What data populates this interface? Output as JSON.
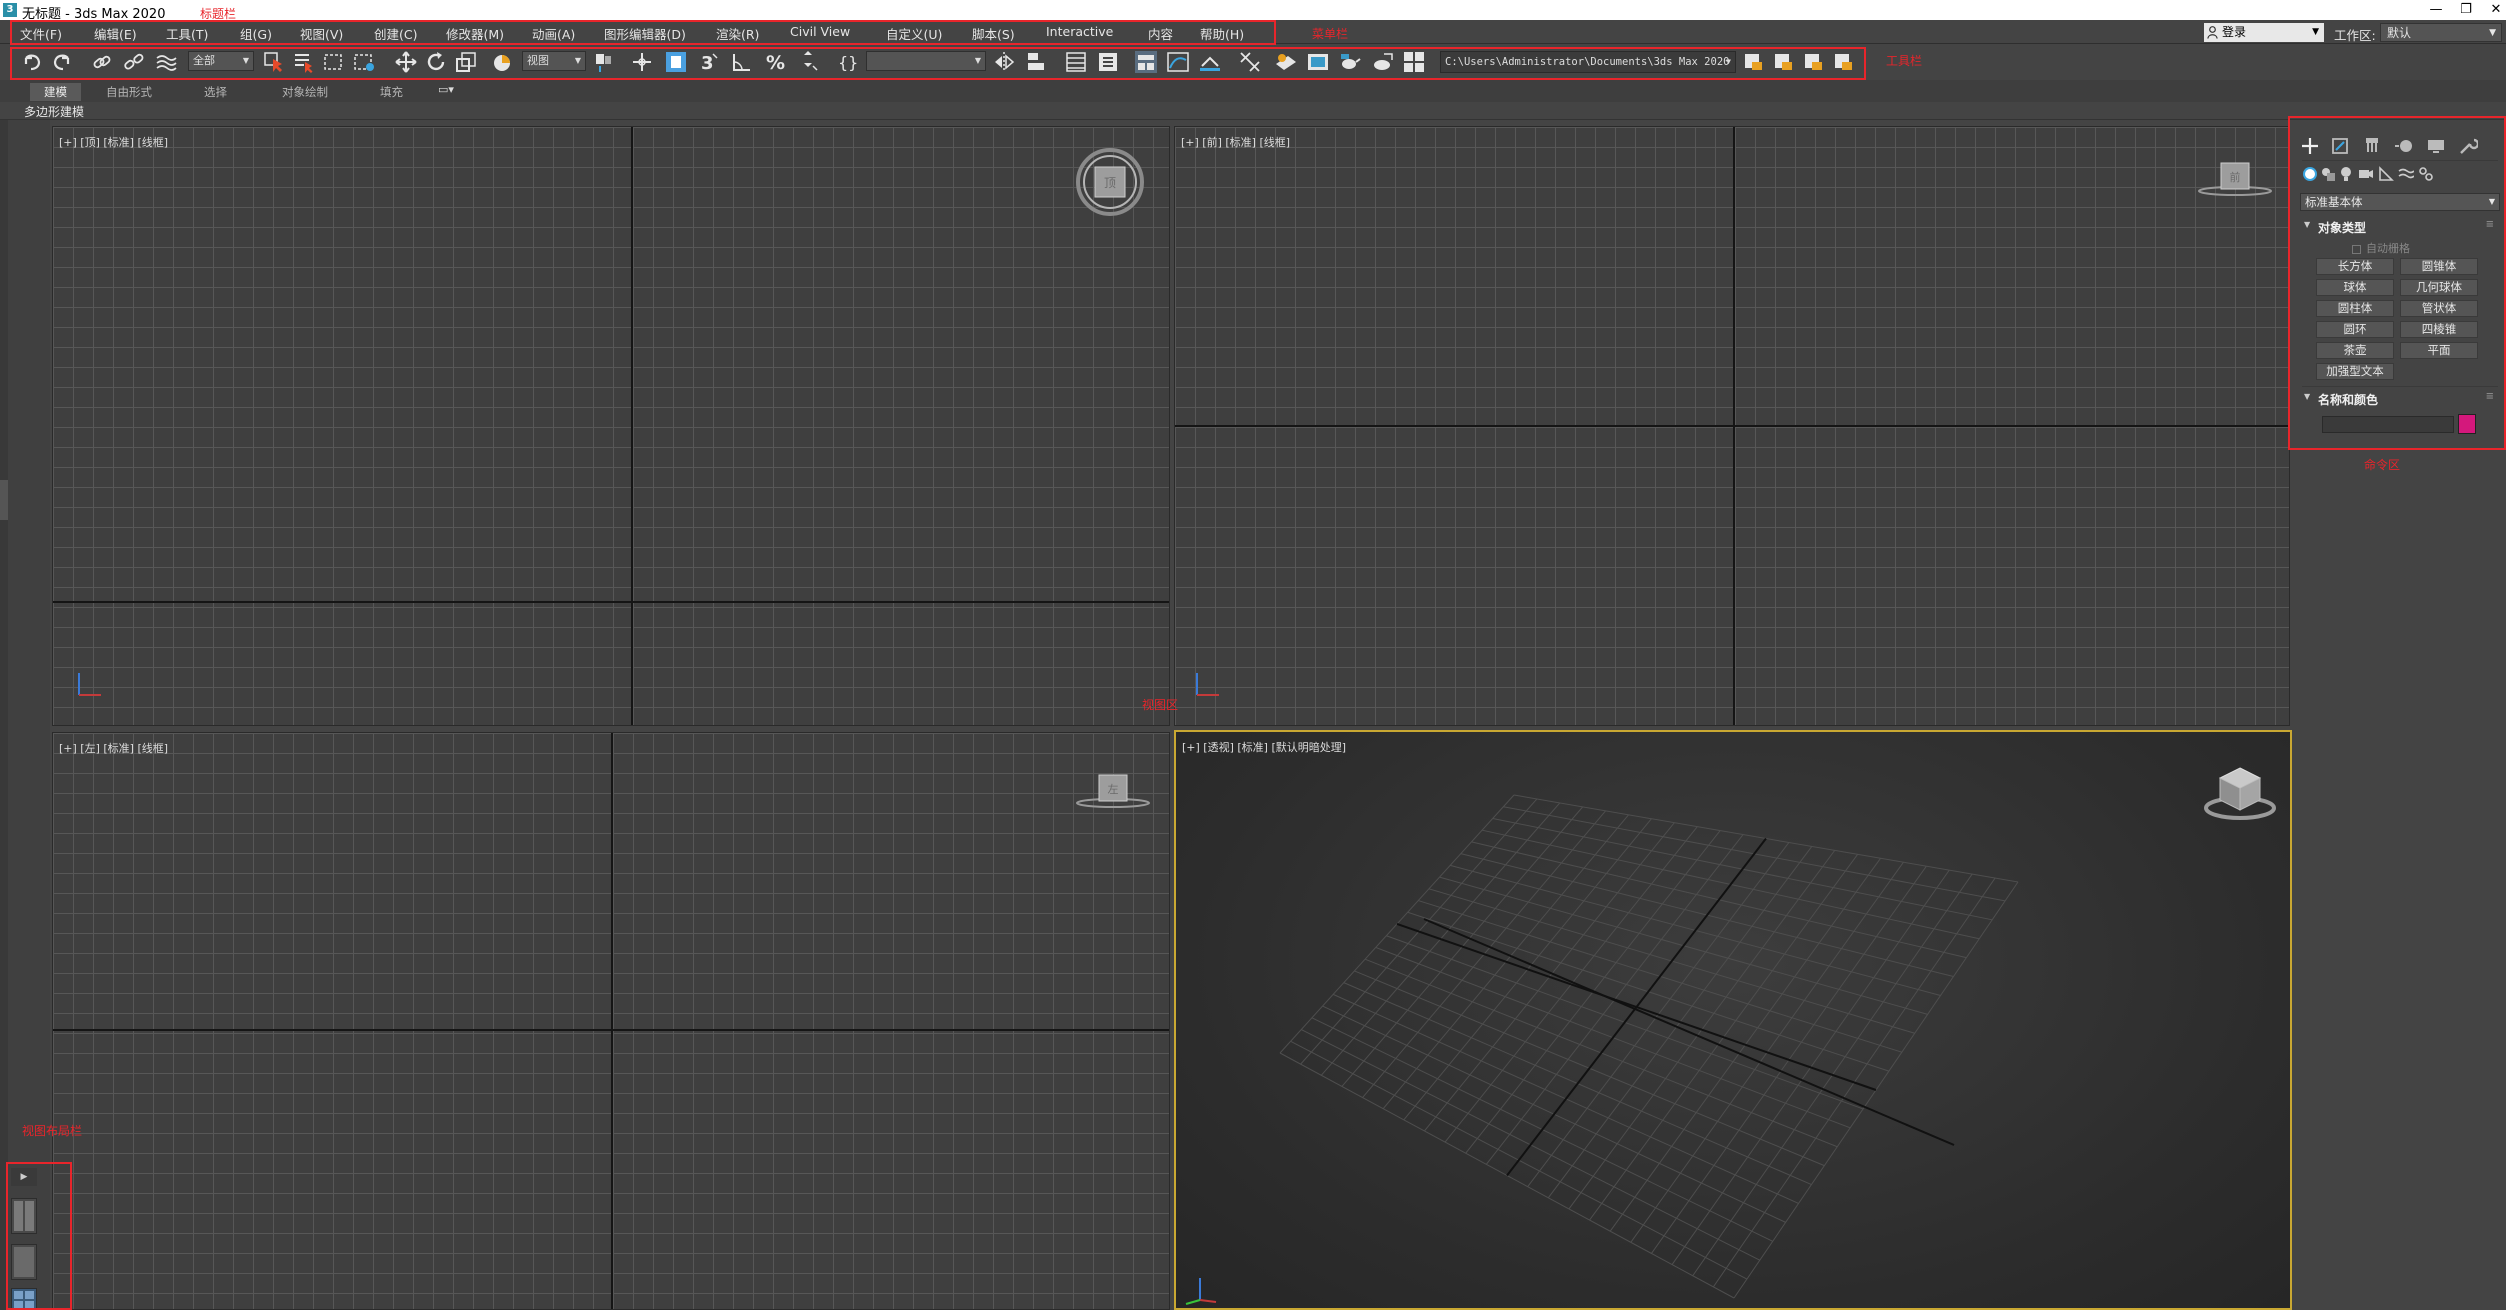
{
  "window": {
    "title": "无标题 - 3ds Max 2020",
    "app_icon": "3",
    "min": "—",
    "restore": "❐",
    "close": "✕"
  },
  "annotations": {
    "title_bar": "标题栏",
    "menu_bar": "菜单栏",
    "toolbar": "工具栏",
    "viewport": "视图区",
    "command_panel": "命令区",
    "layout_bar": "视图布局栏"
  },
  "menu": {
    "items": [
      "文件(F)",
      "编辑(E)",
      "工具(T)",
      "组(G)",
      "视图(V)",
      "创建(C)",
      "修改器(M)",
      "动画(A)",
      "图形编辑器(D)",
      "渲染(R)",
      "Civil View",
      "自定义(U)",
      "脚本(S)",
      "Interactive",
      "内容",
      "帮助(H)"
    ],
    "login": "登录",
    "workspace_label": "工作区:",
    "workspace_value": "默认"
  },
  "toolbar": {
    "selection_filter": "全部",
    "ref_coord": "视图",
    "named_selection": "",
    "project_path": "C:\\Users\\Administrator\\Documents\\3ds Max 2020"
  },
  "ribbon": {
    "tabs": [
      "建模",
      "自由形式",
      "选择",
      "对象绘制",
      "填充"
    ],
    "active_tab": "建模",
    "panel_label": "多边形建模"
  },
  "viewports": {
    "top": "[+] [顶] [标准] [线框]",
    "front": "[+] [前] [标准] [线框]",
    "left": "[+] [左] [标准] [线框]",
    "perspective": "[+] [透视] [标准] [默认明暗处理]",
    "cube_top": "顶",
    "cube_front": "前",
    "cube_left": "左"
  },
  "command_panel": {
    "tabs": [
      "create-icon",
      "modify-icon",
      "hierarchy-icon",
      "motion-icon",
      "display-icon",
      "utilities-icon"
    ],
    "category": "标准基本体",
    "object_type_title": "对象类型",
    "autogrid": "自动栅格",
    "object_buttons": [
      "长方体",
      "圆锥体",
      "球体",
      "几何球体",
      "圆柱体",
      "管状体",
      "圆环",
      "四棱锥",
      "茶壶",
      "平面"
    ],
    "extended_text": "加强型文本",
    "name_color_title": "名称和颜色",
    "object_color": "#d4187c"
  },
  "colors": {
    "annotation": "#e8252b",
    "active_viewport_border": "#c9a832"
  }
}
